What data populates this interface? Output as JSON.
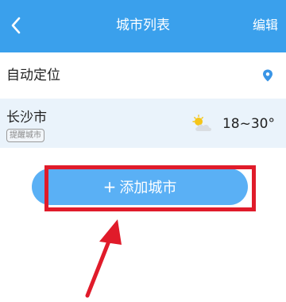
{
  "header": {
    "title": "城市列表",
    "edit_label": "编辑"
  },
  "auto_location": {
    "label": "自动定位",
    "icon": "location-pin-icon"
  },
  "cities": [
    {
      "name": "长沙市",
      "badge": "提醒城市",
      "weather_icon": "partly-cloudy-icon",
      "temperature": "18~30°"
    }
  ],
  "add_city": {
    "plus": "+",
    "label": "添加城市"
  },
  "colors": {
    "header_bg": "#3aa0ec",
    "button_bg": "#5ab0f5",
    "annotation": "#e01b2a"
  }
}
